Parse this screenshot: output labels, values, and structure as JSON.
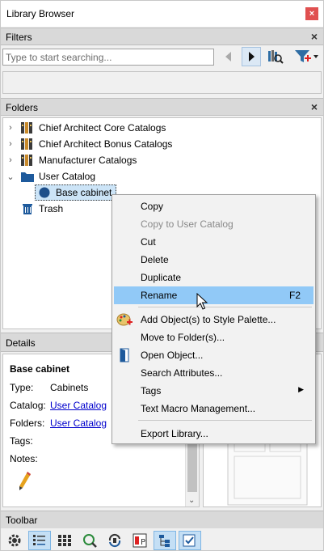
{
  "window": {
    "title": "Library Browser",
    "close_glyph": "×"
  },
  "filters": {
    "header": "Filters",
    "close_glyph": "×",
    "search_placeholder": "Type to start searching...",
    "icons": [
      "back-arrow-icon",
      "forward-arrow-icon",
      "library-search-icon",
      "add-filter-icon"
    ]
  },
  "folders": {
    "header": "Folders",
    "close_glyph": "×",
    "items": [
      {
        "label": "Chief Architect Core Catalogs",
        "icon": "books-icon",
        "chevron": "›"
      },
      {
        "label": "Chief Architect Bonus Catalogs",
        "icon": "books-icon",
        "chevron": "›"
      },
      {
        "label": "Manufacturer Catalogs",
        "icon": "books-icon",
        "chevron": "›"
      },
      {
        "label": "User Catalog",
        "icon": "folder-icon",
        "chevron": "⌄"
      },
      {
        "label": "Base cabinet",
        "icon": "object-icon"
      },
      {
        "label": "Trash",
        "icon": "trash-icon"
      }
    ]
  },
  "details": {
    "header": "Details",
    "close_glyph": "×",
    "name": "Base cabinet",
    "rows": [
      {
        "key": "Type:",
        "value": "Cabinets",
        "link": false
      },
      {
        "key": "Catalog:",
        "value": "User Catalog",
        "link": true
      },
      {
        "key": "Folders:",
        "value": "User Catalog",
        "link": true
      },
      {
        "key": "Tags:",
        "value": "",
        "link": false
      },
      {
        "key": "Notes:",
        "value": "",
        "link": false
      }
    ]
  },
  "toolbar": {
    "header": "Toolbar",
    "icons": [
      "settings-icon",
      "list-view-icon",
      "grid-view-icon",
      "refresh-search-icon",
      "sync-icon",
      "properties-icon",
      "tree-view-icon",
      "checklist-icon"
    ]
  },
  "context_menu": {
    "items": [
      {
        "label": "Copy",
        "disabled": false
      },
      {
        "label": "Copy to User Catalog",
        "disabled": true
      },
      {
        "label": "Cut",
        "disabled": false
      },
      {
        "label": "Delete",
        "disabled": false
      },
      {
        "label": "Duplicate",
        "disabled": false
      },
      {
        "label": "Rename",
        "shortcut": "F2",
        "hover": true
      },
      {
        "label": "Add Object(s) to Style Palette...",
        "icon": "palette-icon"
      },
      {
        "label": "Move to Folder(s)..."
      },
      {
        "label": "Open Object...",
        "icon": "open-object-icon"
      },
      {
        "label": "Search Attributes..."
      },
      {
        "label": "Tags",
        "submenu": "▶"
      },
      {
        "label": "Text Macro Management..."
      },
      {
        "label": "Export Library..."
      }
    ]
  },
  "colors": {
    "accent_hover": "#91c9f7",
    "selected_bg": "#cce4f7",
    "link": "#0000cc",
    "close_red": "#e05050"
  }
}
